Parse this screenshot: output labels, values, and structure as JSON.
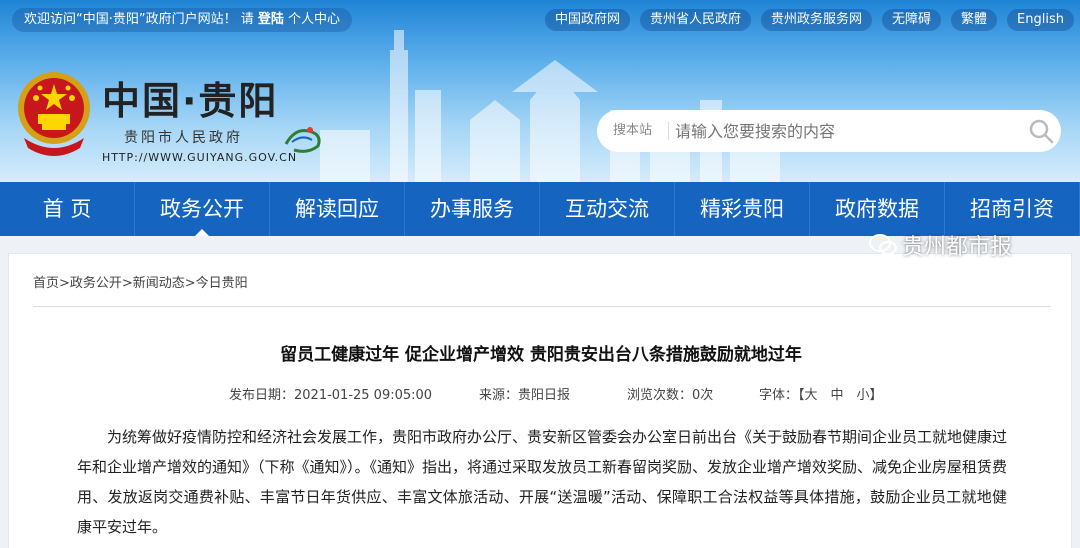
{
  "topbar": {
    "welcome_prefix": "欢迎访问“中国·贵阳”政府门户网站！ 请",
    "login": "登陆",
    "user_center": "个人中心"
  },
  "toplinks": [
    "中国政府网",
    "贵州省人民政府",
    "贵州政务服务网",
    "无障碍",
    "繁體",
    "English"
  ],
  "brand": {
    "title": "中国·贵阳",
    "subtitle": "贵阳市人民政府",
    "url": "HTTP://WWW.GUIYANG.GOV.CN"
  },
  "search": {
    "site_label": "搜本站",
    "placeholder": "请输入您要搜索的内容"
  },
  "nav": [
    "首 页",
    "政务公开",
    "解读回应",
    "办事服务",
    "互动交流",
    "精彩贵阳",
    "政府数据",
    "招商引资"
  ],
  "breadcrumb": "首页>政务公开>新闻动态>今日贵阳",
  "article": {
    "title": "留员工健康过年 促企业增产增效 贵阳贵安出台八条措施鼓励就地过年",
    "publish_date": "发布日期：2021-01-25 09:05:00",
    "source": "来源：贵阳日报",
    "views": "浏览次数：0次",
    "font_size": "字体：【大　中　小】",
    "body": "为统筹做好疫情防控和经济社会发展工作，贵阳市政府办公厅、贵安新区管委会办公室日前出台《关于鼓励春节期间企业员工就地健康过年和企业增产增效的通知》（下称《通知》）。《通知》指出，将通过采取发放员工新春留岗奖励、发放企业增产增效奖励、减免企业房屋租赁费用、发放返岗交通费补贴、丰富节日年货供应、丰富文体旅活动、开展“送温暖”活动、保障职工合法权益等具体措施，鼓励企业员工就地健康平安过年。"
  },
  "watermark": "贵州都市报",
  "colors": {
    "nav": "#1565c0",
    "header_top": "#1f84d6"
  }
}
